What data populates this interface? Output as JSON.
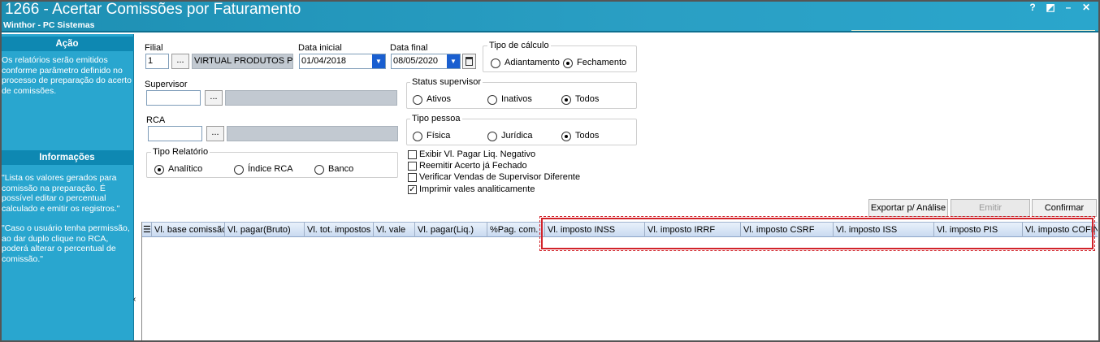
{
  "window": {
    "title": "1266 - Acertar Comissões por Faturamento",
    "subtitle": "Winthor - PC Sistemas",
    "controls": {
      "help": "?",
      "restore": "◩",
      "minimize": "–",
      "close": "✕"
    }
  },
  "sidebar": {
    "acao_header": "Ação",
    "acao_text": "Os relatórios serão emitidos conforme parâmetro definido no processo de preparação do acerto de comissões.",
    "info_header": "Informações",
    "info_text1": "\"Lista os valores gerados para comissão na preparação. É possível editar o percentual calculado e emitir os registros.\"",
    "info_text2": "\"Caso o usuário tenha permissão, ao dar duplo clique no RCA, poderá alterar o percentual de comissão.\""
  },
  "filters": {
    "filial_label": "Filial",
    "filial_code": "1",
    "filial_name": "VIRTUAL PRODUTOS PES",
    "data_inicial_label": "Data inicial",
    "data_inicial": "01/04/2018",
    "data_final_label": "Data final",
    "data_final": "08/05/2020",
    "supervisor_label": "Supervisor",
    "rca_label": "RCA",
    "dots": "..."
  },
  "tipo_calculo": {
    "title": "Tipo de cálculo",
    "options": [
      "Adiantamento",
      "Fechamento"
    ],
    "selected": "Fechamento"
  },
  "status_supervisor": {
    "title": "Status supervisor",
    "options": [
      "Ativos",
      "Inativos",
      "Todos"
    ],
    "selected": "Todos"
  },
  "tipo_pessoa": {
    "title": "Tipo pessoa",
    "options": [
      "Física",
      "Jurídica",
      "Todos"
    ],
    "selected": "Todos"
  },
  "tipo_relatorio": {
    "title": "Tipo Relatório",
    "options": [
      "Analítico",
      "Índice RCA",
      "Banco"
    ],
    "selected": "Analítico"
  },
  "checkboxes": [
    {
      "label": "Exibir Vl. Pagar Liq. Negativo",
      "checked": false
    },
    {
      "label": "Reemitir Acerto já Fechado",
      "checked": false
    },
    {
      "label": "Verificar Vendas de Supervisor Diferente",
      "checked": false
    },
    {
      "label": "Imprimir vales analiticamente",
      "checked": true
    }
  ],
  "actions": {
    "exportar": "Exportar p/ Análise",
    "emitir": "Emitir",
    "confirmar": "Confirmar"
  },
  "grid": {
    "columns": [
      "Vl. base comissão",
      "Vl. pagar(Bruto)",
      "Vl. tot. impostos",
      "Vl. vale",
      "Vl. pagar(Liq.)",
      "%Pag. com.",
      "Vl. imposto INSS",
      "Vl. imposto IRRF",
      "Vl. imposto CSRF",
      "Vl. imposto ISS",
      "Vl. imposto PIS",
      "Vl. imposto COFINS"
    ]
  },
  "colors": {
    "titlebar": "#1d8fb3",
    "sidebar": "#29a6cf",
    "highlight": "#d2232a"
  }
}
